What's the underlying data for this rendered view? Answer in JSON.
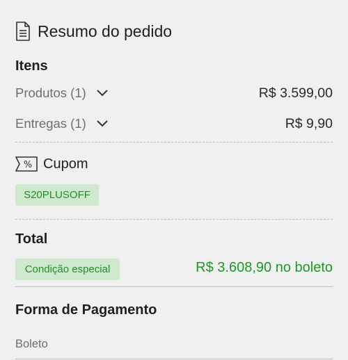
{
  "header": {
    "title": "Resumo do pedido",
    "icon": "document-icon"
  },
  "items": {
    "heading": "Itens",
    "rows": [
      {
        "label": "Produtos (1)",
        "value": "R$ 3.599,00"
      },
      {
        "label": "Entregas (1)",
        "value": "R$ 9,90"
      }
    ]
  },
  "coupon": {
    "heading": "Cupom",
    "icon": "coupon-icon",
    "code": "S20PLUSOFF"
  },
  "total": {
    "heading": "Total",
    "badge": "Condição especial",
    "value": "R$ 3.608,90 no boleto"
  },
  "payment": {
    "heading": "Forma de Pagamento",
    "method": "Boleto"
  },
  "colors": {
    "green_text": "#1b9a23",
    "green_chip_bg": "#cfe9cf",
    "page_bg": "#f0f0f0"
  }
}
